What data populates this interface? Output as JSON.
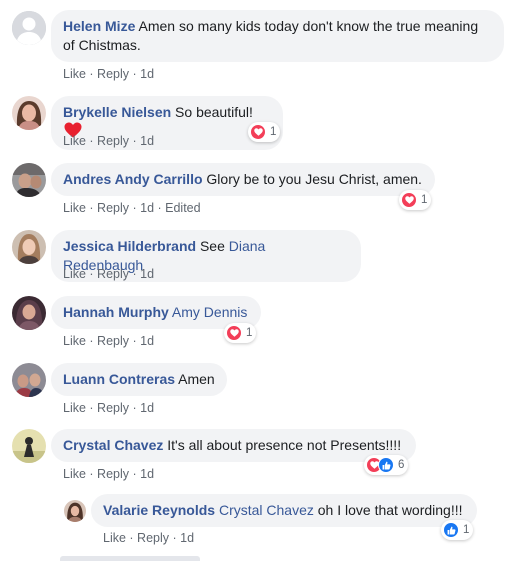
{
  "comments": [
    {
      "author": "Helen Mize",
      "text": " Amen so many kids today don't know the true meaning of Chistmas.",
      "like": "Like",
      "reply": "Reply",
      "time": "1d",
      "avatar_color": "#bec3c9"
    },
    {
      "author": "Brykelle Nielsen",
      "text": " So beautiful!",
      "like": "Like",
      "reply": "Reply",
      "time": "1d",
      "reaction_count": "1",
      "avatar_color": "#c98f86"
    },
    {
      "author": "Andres Andy Carrillo",
      "text": " Glory be to you Jesu Christ, amen.",
      "like": "Like",
      "reply": "Reply",
      "time": "1d",
      "edited": "Edited",
      "reaction_count": "1",
      "avatar_color": "#6d6a6b"
    },
    {
      "author": "Jessica Hilderbrand",
      "text": " See ",
      "mention": "Diana Redenbaugh",
      "like": "Like",
      "reply": "Reply",
      "time": "1d",
      "avatar_color": "#b99580"
    },
    {
      "author": "Hannah Murphy",
      "text": " ",
      "mention": "Amy Dennis",
      "like": "Like",
      "reply": "Reply",
      "time": "1d",
      "reaction_count": "1",
      "avatar_color": "#5a3d4a"
    },
    {
      "author": "Luann Contreras",
      "text": " Amen",
      "like": "Like",
      "reply": "Reply",
      "time": "1d",
      "avatar_color": "#7d7b86"
    },
    {
      "author": "Crystal Chavez",
      "text": " It's all about presence not Presents!!!!",
      "like": "Like",
      "reply": "Reply",
      "time": "1d",
      "reaction_count": "6",
      "avatar_color": "#c8c48a"
    },
    {
      "author": "Valarie Reynolds",
      "text": " oh I love that wording!!!",
      "mention": "Crystal Chavez",
      "like": "Like",
      "reply": "Reply",
      "time": "1d",
      "reaction_count": "1",
      "avatar_color": "#a87d6c"
    }
  ],
  "colors": {
    "link": "#385898",
    "bubble": "#f2f3f5",
    "meta": "#606770",
    "love": "#f33e58",
    "like": "#1877f2"
  },
  "icons": {
    "love_reaction": "heart-icon",
    "like_reaction": "thumbs-up-icon",
    "emoji": "red-heart-emoji"
  },
  "separator": " · "
}
